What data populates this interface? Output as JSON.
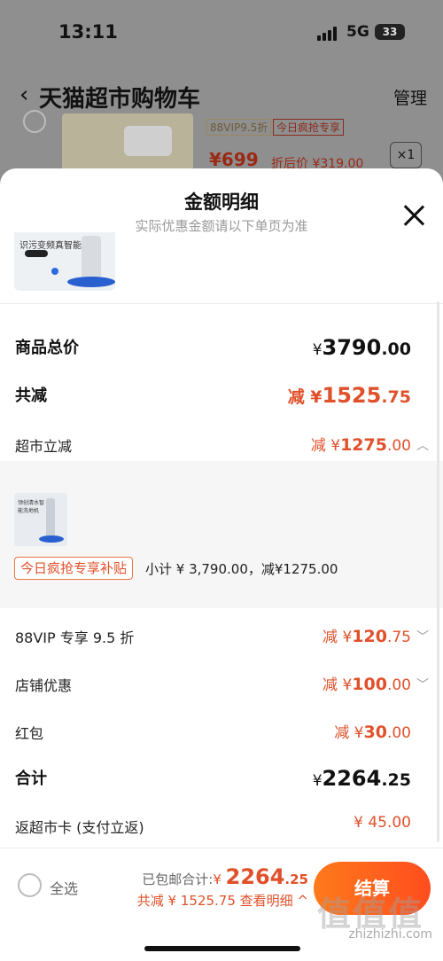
{
  "status_bar": {
    "time": "13:11",
    "network": "5G",
    "battery": "33"
  },
  "nav": {
    "back_icon": "‹",
    "title": "天猫超市购物车",
    "manage": "管理"
  },
  "bg_item": {
    "tag_vip": "88VIP9.5折",
    "tag_flash": "今日疯抢专享",
    "price": "¥699",
    "after_price": "折后价 ¥319.00",
    "qty": "×1"
  },
  "sheet": {
    "title": "金额明细",
    "subtitle": "实际优惠金额请以下单页为准",
    "product_image_caption": "识污变频真智能",
    "rows": {
      "total_price": {
        "label": "商品总价",
        "prefix": "¥",
        "int": "3790",
        "dec": ".00"
      },
      "total_discount": {
        "label": "共减",
        "prefix": "减 ¥",
        "int": "1525",
        "dec": ".75"
      },
      "market_discount": {
        "label": "超市立减",
        "prefix": "减 ¥",
        "int": "1275",
        "dec": ".00"
      },
      "vip": {
        "label": "88VIP 专享 9.5 折",
        "prefix": "减 ¥",
        "int": "120",
        "dec": ".75"
      },
      "store": {
        "label": "店铺优惠",
        "prefix": "减 ¥",
        "int": "100",
        "dec": ".00"
      },
      "redpacket": {
        "label": "红包",
        "prefix": "减 ¥",
        "int": "30",
        "dec": ".00"
      },
      "sum": {
        "label": "合计",
        "prefix": "¥",
        "int": "2264",
        "dec": ".25"
      },
      "card": {
        "label": "返超市卡 (支付立返)",
        "value": "¥ 45.00"
      }
    },
    "detail": {
      "image_caption": "领创清水智能洗地机",
      "tag": "今日疯抢专享补贴",
      "subtotal": "小计 ¥ 3,790.00，减¥1275.00"
    }
  },
  "bottom": {
    "select_all": "全选",
    "shipping_total_label": "已包邮合计:",
    "total_prefix": "¥ ",
    "total_int": "2264",
    "total_dec": ".25",
    "discount_line": "共减 ¥ 1525.75  查看明细 ^",
    "checkout": "结算"
  },
  "watermark": {
    "logo": "值值值",
    "text": "zhizhizhi.com"
  },
  "colors": {
    "accent": "#e0502a",
    "checkout_start": "#ff7a1a",
    "checkout_end": "#ff4d1f"
  }
}
